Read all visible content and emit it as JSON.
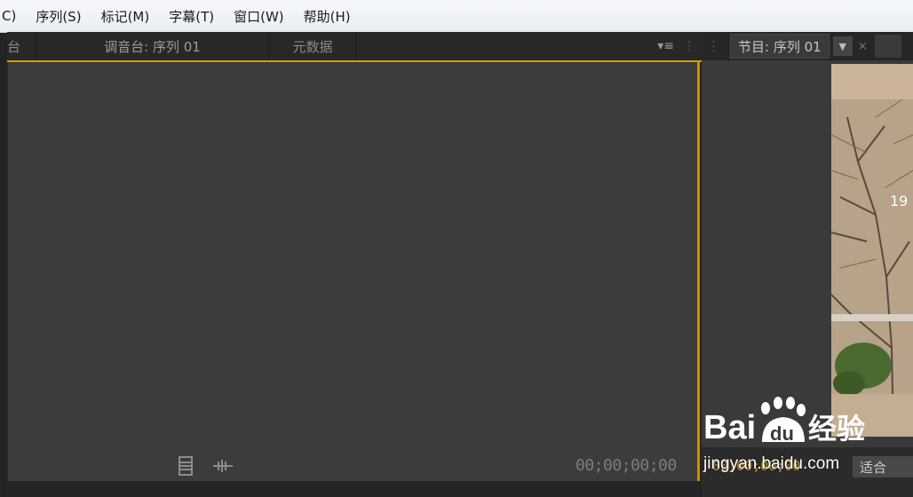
{
  "menu": [
    "C)",
    "序列(S)",
    "标记(M)",
    "字幕(T)",
    "窗口(W)",
    "帮助(H)"
  ],
  "left_panel": {
    "tabs": [
      "台",
      "调音台: 序列 01",
      "元数据"
    ],
    "panel_menu_icon": "menu-lines-icon",
    "timecode": "00;00;00;00",
    "icons": [
      "film-strip-icon",
      "audio-waveform-icon"
    ]
  },
  "right_panel": {
    "tab_label": "节目: 序列 01",
    "dropdown_icon": "▼",
    "close_icon": "×",
    "fit_select": "适合",
    "preview_overlay_text": "19",
    "timecode": "00;00;00;00"
  },
  "watermark": {
    "logo": "Bai du 经验",
    "url": "jingyan.baidu.com"
  }
}
